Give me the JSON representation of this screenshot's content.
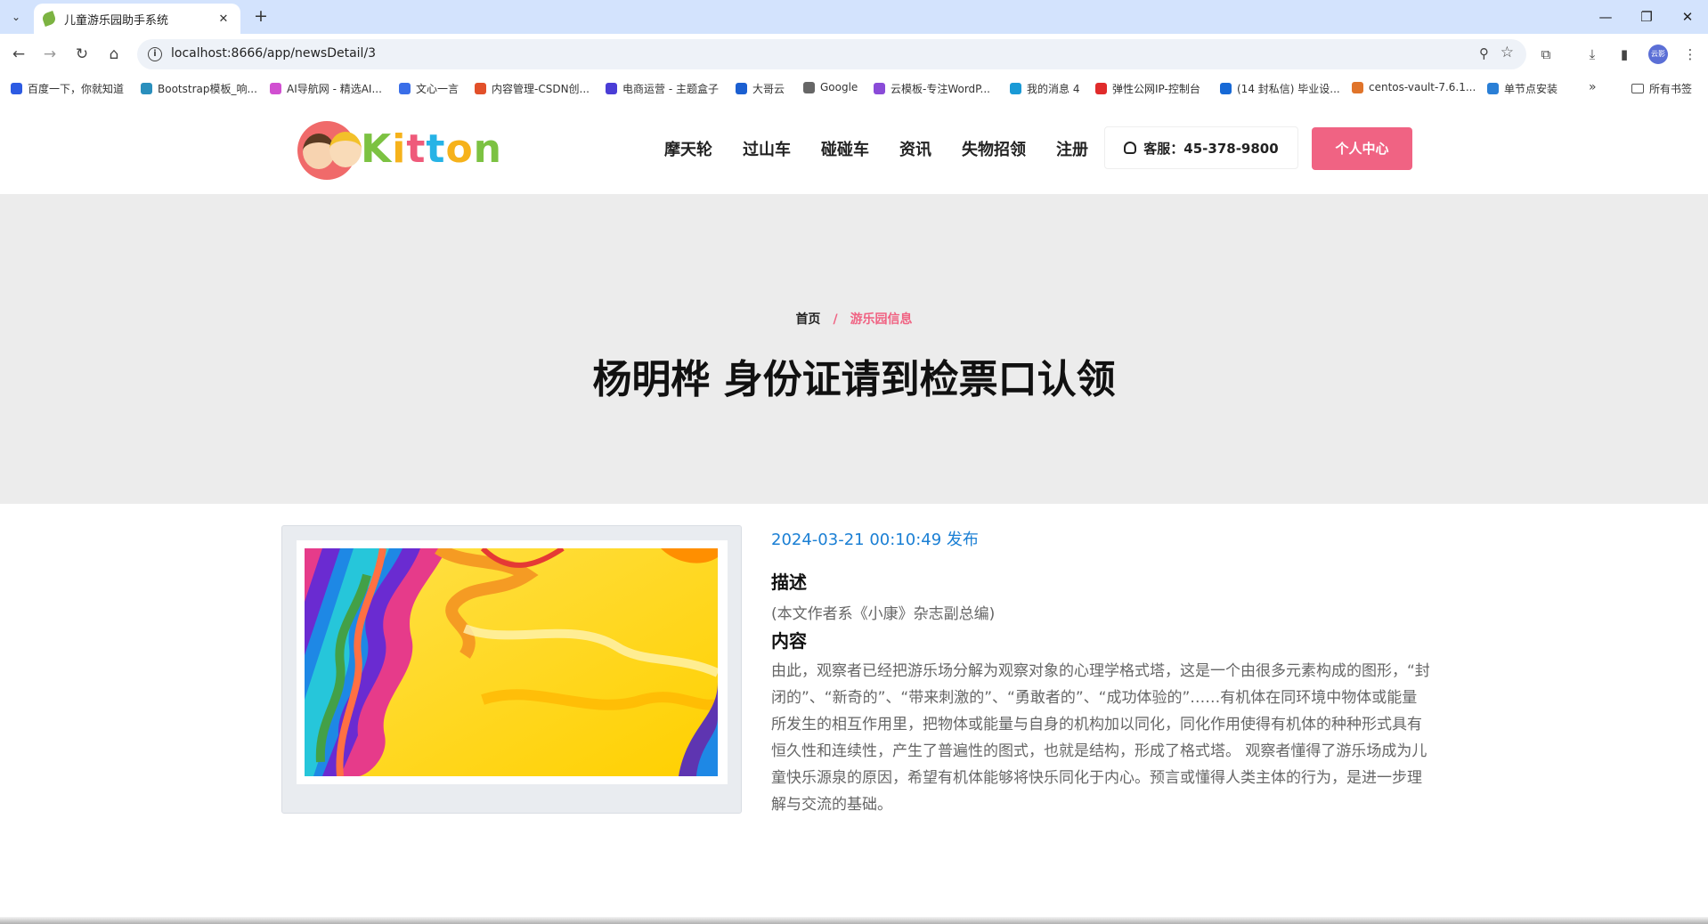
{
  "browser": {
    "tab_title": "儿童游乐园助手系统",
    "url": "localhost:8666/app/newsDetail/3",
    "bookmarks": [
      {
        "label": "百度一下，你就知道",
        "color": "#2d5be3"
      },
      {
        "label": "Bootstrap模板_响...",
        "color": "#2a8fbd"
      },
      {
        "label": "AI导航网 - 精选AI...",
        "color": "#d14fd1"
      },
      {
        "label": "文心一言",
        "color": "#3a6ee8"
      },
      {
        "label": "内容管理-CSDN创...",
        "color": "#e2502a"
      },
      {
        "label": "电商运营 - 主题盒子",
        "color": "#4a3dd6"
      },
      {
        "label": "大哥云",
        "color": "#1b5fd1"
      },
      {
        "label": "Google",
        "color": "#666666"
      },
      {
        "label": "云模板-专注WordP...",
        "color": "#8a4bd8"
      },
      {
        "label": "我的消息 4",
        "color": "#1a9ad6"
      },
      {
        "label": "弹性公网IP-控制台",
        "color": "#e02b2b"
      },
      {
        "label": "(14 封私信) 毕业设...",
        "color": "#1769d6"
      },
      {
        "label": "centos-vault-7.6.1...",
        "color": "#e0742a"
      },
      {
        "label": "单节点安装",
        "color": "#2a7fd6"
      }
    ],
    "all_bookmarks": "所有书签",
    "profile_label": "云影"
  },
  "site": {
    "logo_text": [
      "K",
      "i",
      "t",
      "t",
      "o",
      "n"
    ],
    "nav": [
      "摩天轮",
      "过山车",
      "碰碰车",
      "资讯",
      "失物招领",
      "注册"
    ],
    "hotline": "客服：45-378-9800",
    "user_center": "个人中心"
  },
  "banner": {
    "breadcrumb_home": "首页",
    "breadcrumb_sep": "/",
    "breadcrumb_current": "游乐园信息",
    "title": "杨明桦 身份证请到检票口认领"
  },
  "article": {
    "published": "2024-03-21 00:10:49 发布",
    "desc_heading": "描述",
    "desc": "(本文作者系《小康》杂志副总编)",
    "content_heading": "内容",
    "content": "由此，观察者已经把游乐场分解为观察对象的心理学格式塔，这是一个由很多元素构成的图形，“封闭的”、“新奇的”、“带来刺激的”、“勇敢者的”、“成功体验的”……有机体在同环境中物体或能量所发生的相互作用里，把物体或能量与自身的机构加以同化，同化作用使得有机体的种种形式具有恒久性和连续性，产生了普遍性的图式，也就是结构，形成了格式塔。 观察者懂得了游乐场成为儿童快乐源泉的原因，希望有机体能够将快乐同化于内心。预言或懂得人类主体的行为，是进一步理解与交流的基础。"
  },
  "colors": {
    "accent": "#f06383",
    "date_blue": "#1a7fd4",
    "banner_bg": "#ececec"
  }
}
